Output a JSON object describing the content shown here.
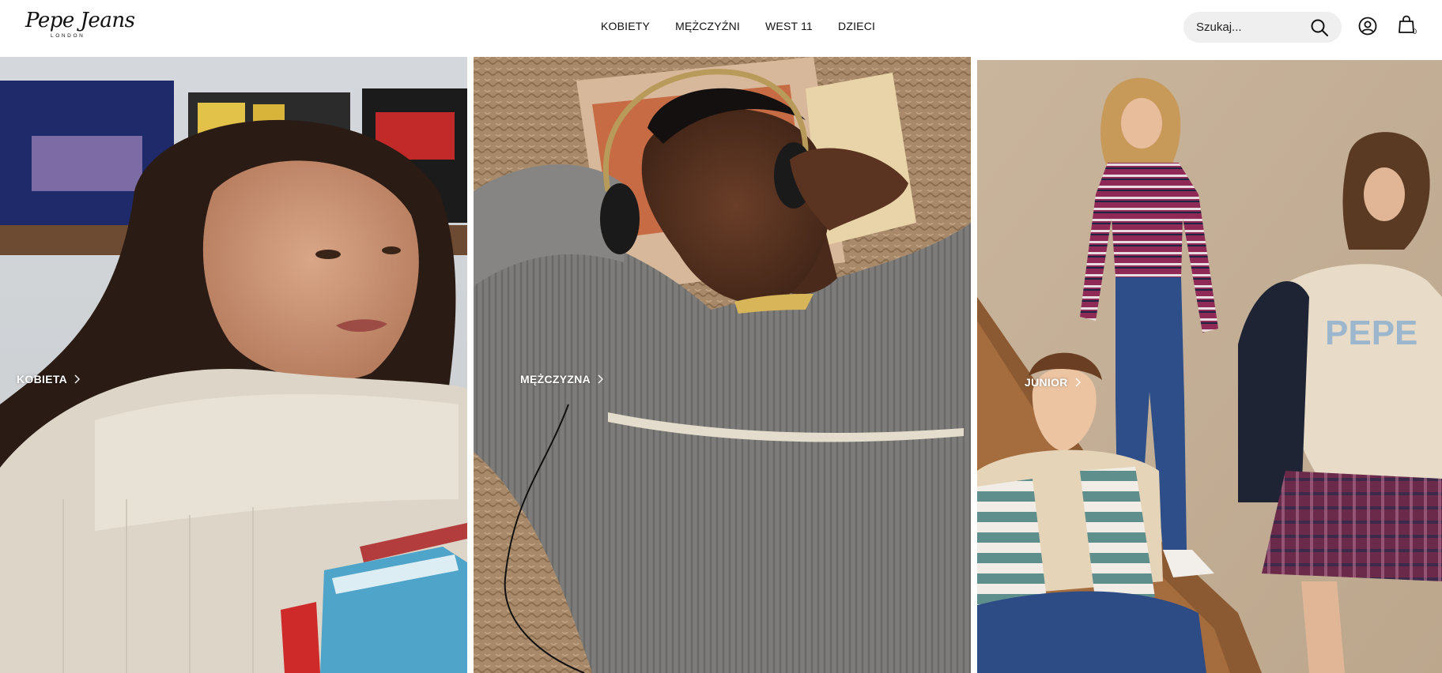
{
  "header": {
    "logo": {
      "main": "Pepe Jeans",
      "sub": "LONDON"
    },
    "nav": [
      "KOBIETY",
      "MĘŻCZYŹNI",
      "WEST 11",
      "DZIECI"
    ],
    "search": {
      "placeholder": "Szukaj...",
      "icon": "search-icon"
    },
    "account_icon": "user-circle-icon",
    "cart": {
      "icon": "shopping-bag-icon",
      "count": "0"
    }
  },
  "panels": [
    {
      "label": "KOBIETA",
      "icon": "chevron-right-icon"
    },
    {
      "label": "MĘŻCZYZNA",
      "icon": "chevron-right-icon"
    },
    {
      "label": "JUNIOR",
      "icon": "chevron-right-icon"
    }
  ],
  "colors": {
    "header_bg": "#ffffff",
    "text": "#111111",
    "search_bg": "#efefef",
    "label_text": "#ffffff"
  }
}
